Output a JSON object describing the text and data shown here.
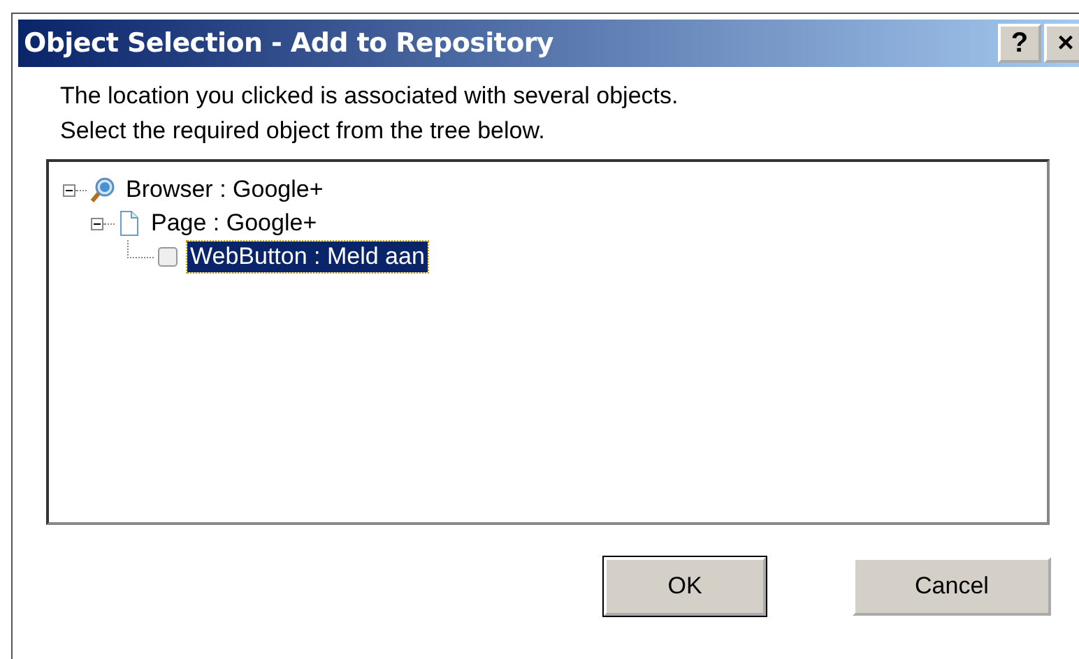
{
  "window": {
    "title": "Object Selection - Add to Repository",
    "help_button": "?",
    "close_button": "×"
  },
  "instructions": [
    "The location you clicked is associated with several objects.",
    "Select the required object from the tree below."
  ],
  "tree": [
    {
      "label": "Browser : Google+",
      "kind": "browser",
      "expanded": true,
      "selected": false,
      "children": [
        {
          "label": "Page : Google+",
          "kind": "page",
          "expanded": true,
          "selected": false,
          "children": [
            {
              "label": "WebButton : Meld aan",
              "kind": "webbutton",
              "selected": true
            }
          ]
        }
      ]
    }
  ],
  "buttons": [
    {
      "label": "OK",
      "default": true
    },
    {
      "label": "Cancel",
      "default": false
    }
  ]
}
